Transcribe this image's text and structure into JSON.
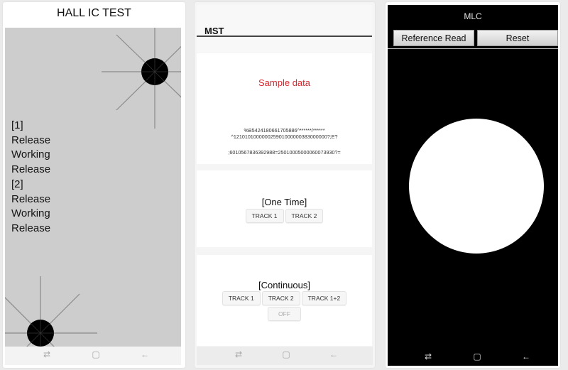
{
  "hall_ic": {
    "title": "HALL IC TEST",
    "log": [
      "[1]",
      "Release",
      "Working",
      "Release",
      "[2]",
      "Release",
      "Working",
      "Release"
    ]
  },
  "mst": {
    "header": "MST",
    "sample_label": "Sample data",
    "track_lines": [
      "%B5424180661705886^******/******",
      "^121010100000025901000000383000000?;E?",
      ";6010567836392988=25010005000060073930?="
    ],
    "one_time": {
      "title": "[One Time]",
      "buttons": [
        "TRACK 1",
        "TRACK 2"
      ]
    },
    "continuous": {
      "title": "[Continuous]",
      "buttons": [
        "TRACK 1",
        "TRACK 2",
        "TRACK 1+2"
      ],
      "off_label": "OFF"
    }
  },
  "mlc": {
    "title": "MLC",
    "reference_read_label": "Reference Read",
    "reset_label": "Reset"
  },
  "navbar": {
    "recents_glyph": "⇄",
    "home_glyph": "▢",
    "back_glyph": "←"
  },
  "colors": {
    "sample_data": "#d9262c",
    "hall_background": "#cdcdcd",
    "mlc_background": "#000000"
  }
}
